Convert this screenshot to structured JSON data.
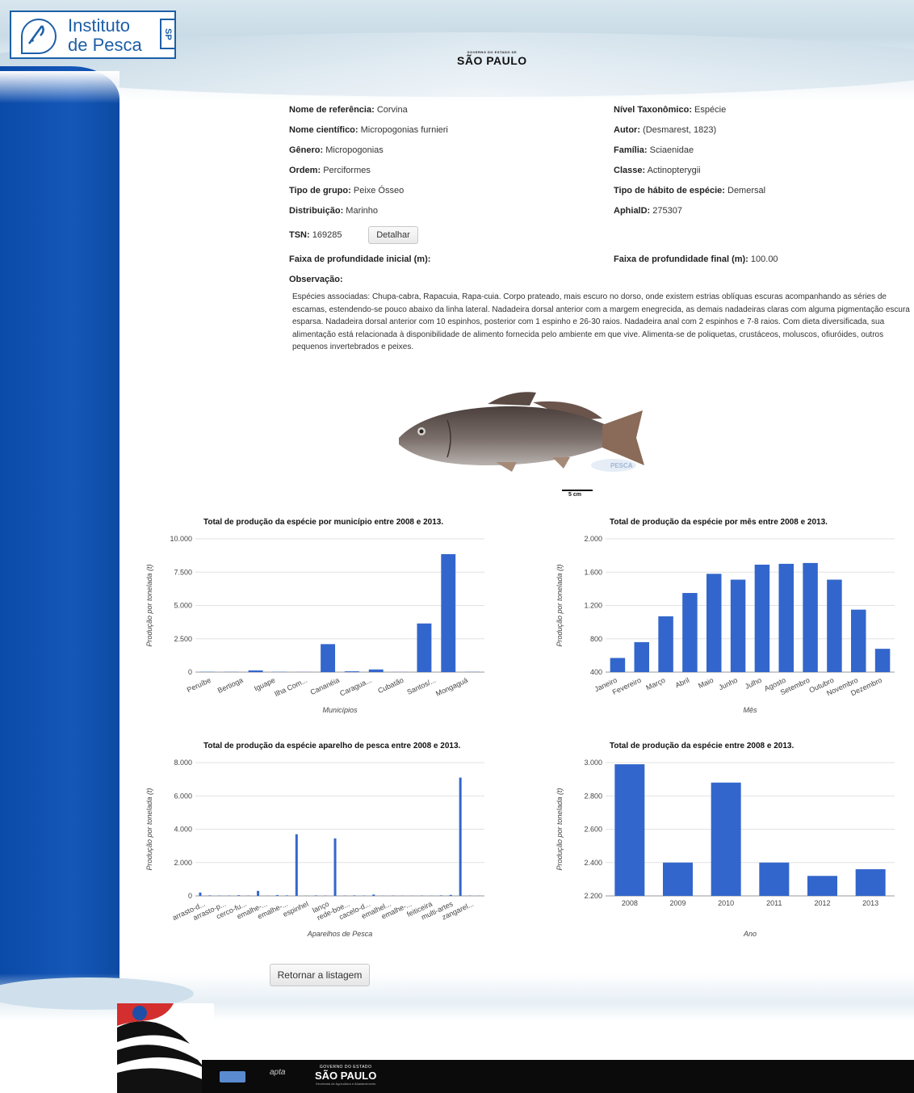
{
  "header": {
    "logo_line1": "Instituto",
    "logo_line2": "de Pesca",
    "logo_sp": "SP",
    "gov_small": "GOVERNO DO ESTADO DE",
    "gov_big": "SÃO PAULO"
  },
  "species": {
    "left": [
      {
        "label": "Nome de referência:",
        "value": "Corvina"
      },
      {
        "label": "Nome científico:",
        "value": "Micropogonias furnieri"
      },
      {
        "label": "Gênero:",
        "value": "Micropogonias"
      },
      {
        "label": "Ordem:",
        "value": "Perciformes"
      },
      {
        "label": "Tipo de grupo:",
        "value": "Peixe Ósseo"
      },
      {
        "label": "Distribuição:",
        "value": "Marinho"
      }
    ],
    "right": [
      {
        "label": "Nível Taxonômico:",
        "value": "Espécie"
      },
      {
        "label": "Autor:",
        "value": "(Desmarest, 1823)"
      },
      {
        "label": "Família:",
        "value": "Sciaenidae"
      },
      {
        "label": "Classe:",
        "value": "Actinopterygii"
      },
      {
        "label": "Tipo de hábito de espécie:",
        "value": "Demersal"
      },
      {
        "label": "AphialD:",
        "value": "275307"
      }
    ],
    "tsn_label": "TSN:",
    "tsn_value": "169285",
    "detail_button": "Detalhar",
    "depth_initial_label": "Faixa de profundidade inicial (m):",
    "depth_initial_value": "",
    "depth_final_label": "Faixa de profundidade final (m):",
    "depth_final_value": "100.00",
    "obs_label": "Observação:",
    "obs_text": "Espécies associadas: Chupa-cabra, Rapacuia, Rapa-cuia. Corpo prateado, mais escuro no dorso, onde existem estrias oblíquas escuras acompanhando as séries de escamas, estendendo-se pouco abaixo da linha lateral. Nadadeira dorsal anterior com a margem enegrecida, as demais nadadeiras claras com alguma pigmentação escura esparsa. Nadadeira dorsal anterior com 10 espinhos, posterior com 1 espinho e 26-30 raios. Nadadeira anal com 2 espinhos e 7-8 raios. Com dieta diversificada, sua alimentação está relacionada à disponibilidade de alimento fornecida pelo ambiente em que vive. Alimenta-se de poliquetas, crustáceos, moluscos, ofiuróides, outros pequenos invertebrados e peixes.",
    "scale_label": "5 cm",
    "watermark": "PESCA"
  },
  "return_button": "Retornar a listagem",
  "footer": {
    "gov_small": "GOVERNO DO ESTADO",
    "gov_big": "SÃO PAULO",
    "gov_sub": "Secretaria de Agricultura e Abastecimento",
    "apta": "apta"
  },
  "colors": {
    "bar": "#3366cc",
    "grid": "#e2e2e2",
    "sidebar": "#0d4ea8"
  },
  "chart_data": [
    {
      "id": "municipio",
      "type": "bar",
      "title": "Total de produção da espécie por município entre 2008 e 2013.",
      "xlabel": "Municípios",
      "ylabel": "Produção por tonelada (t)",
      "ylim": [
        0,
        10000
      ],
      "yticks": [
        0,
        2500,
        5000,
        7500,
        10000
      ],
      "ytick_labels": [
        "0",
        "2.500",
        "5.000",
        "7.500",
        "10.000"
      ],
      "categories": [
        "Peruíbe",
        "Bertioga",
        "Iguape",
        "Ilha Com...",
        "Cananéia",
        "Caragua...",
        "Cubatão",
        "Santos/...",
        "Mongaguá"
      ],
      "bars": [
        {
          "x": "Peruíbe",
          "value": 20
        },
        {
          "x": "Bertioga",
          "value": 15
        },
        {
          "x": "Iguape",
          "value": 130
        },
        {
          "x": "Ilha Com...",
          "value": 20
        },
        {
          "x": "Cananéia",
          "value": 10
        },
        {
          "x": "Cananéia",
          "value": 2100
        },
        {
          "x": "Caragua...",
          "value": 60
        },
        {
          "x": "Cubatão",
          "value": 200
        },
        {
          "x": "Santos/...",
          "value": 10
        },
        {
          "x": "Santos/...",
          "value": 3650
        },
        {
          "x": "Santos/...",
          "value": 8850
        },
        {
          "x": "Mongaguá",
          "value": 15
        }
      ]
    },
    {
      "id": "mes",
      "type": "bar",
      "title": "Total de produção da espécie por mês entre 2008 e 2013.",
      "xlabel": "Mês",
      "ylabel": "Produção por tonelada (t)",
      "ylim": [
        400,
        2000
      ],
      "yticks": [
        400,
        800,
        1200,
        1600,
        2000
      ],
      "ytick_labels": [
        "400",
        "800",
        "1.200",
        "1.600",
        "2.000"
      ],
      "categories": [
        "Janeiro",
        "Fevereiro",
        "Março",
        "Abril",
        "Maio",
        "Junho",
        "Julho",
        "Agosto",
        "Setembro",
        "Outubro",
        "Novembro",
        "Dezembro"
      ],
      "values": [
        570,
        760,
        1070,
        1350,
        1580,
        1510,
        1690,
        1700,
        1710,
        1510,
        1150,
        680
      ]
    },
    {
      "id": "aparelho",
      "type": "bar",
      "title": "Total de produção da espécie aparelho de pesca entre 2008 e 2013.",
      "xlabel": "Aparelhos de Pesca",
      "ylabel": "Produção por tonelada (t)",
      "ylim": [
        0,
        8000
      ],
      "yticks": [
        0,
        2000,
        4000,
        6000,
        8000
      ],
      "ytick_labels": [
        "0",
        "2.000",
        "4.000",
        "6.000",
        "8.000"
      ],
      "categories": [
        "arrasto-d...",
        "arrasto-p...",
        "cerco-fu...",
        "emalhe-...",
        "emalhe-...",
        "espinhel",
        "lanço",
        "rede-boe...",
        "cacelo-d...",
        "emalhel...",
        "emalhe-...",
        "feiticeira",
        "multi-artes",
        "zangarel..."
      ],
      "values": [
        200,
        30,
        20,
        20,
        40,
        20,
        300,
        10,
        50,
        30,
        3700,
        10,
        30,
        20,
        3450,
        20,
        30,
        20,
        80,
        10,
        20,
        10,
        10,
        20,
        10,
        30,
        60,
        7100,
        20,
        10
      ]
    },
    {
      "id": "ano",
      "type": "bar",
      "title": "Total de produção da espécie entre 2008 e 2013.",
      "xlabel": "Ano",
      "ylabel": "Produção por tonelada (t)",
      "ylim": [
        2200,
        3000
      ],
      "yticks": [
        2200,
        2400,
        2600,
        2800,
        3000
      ],
      "ytick_labels": [
        "2.200",
        "2.400",
        "2.600",
        "2.800",
        "3.000"
      ],
      "categories": [
        "2008",
        "2009",
        "2010",
        "2011",
        "2012",
        "2013"
      ],
      "values": [
        2990,
        2400,
        2880,
        2400,
        2320,
        2360
      ]
    }
  ]
}
